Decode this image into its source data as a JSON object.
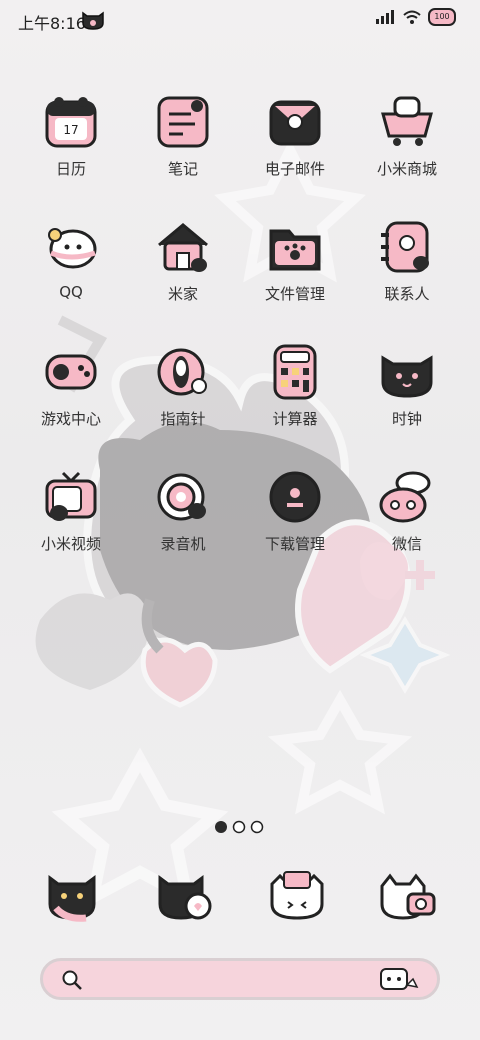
{
  "status_bar": {
    "time": "上午8:16",
    "battery": "100"
  },
  "apps": [
    {
      "label": "日历",
      "icon": "calendar-icon",
      "date": "17"
    },
    {
      "label": "笔记",
      "icon": "notes-icon"
    },
    {
      "label": "电子邮件",
      "icon": "email-icon"
    },
    {
      "label": "小米商城",
      "icon": "shop-cart-icon"
    },
    {
      "label": "QQ",
      "icon": "qq-icon"
    },
    {
      "label": "米家",
      "icon": "home-icon"
    },
    {
      "label": "文件管理",
      "icon": "folder-icon"
    },
    {
      "label": "联系人",
      "icon": "contacts-icon"
    },
    {
      "label": "游戏中心",
      "icon": "gamepad-icon"
    },
    {
      "label": "指南针",
      "icon": "compass-icon"
    },
    {
      "label": "计算器",
      "icon": "calculator-icon"
    },
    {
      "label": "时钟",
      "icon": "clock-icon"
    },
    {
      "label": "小米视频",
      "icon": "tv-icon"
    },
    {
      "label": "录音机",
      "icon": "recorder-icon"
    },
    {
      "label": "下载管理",
      "icon": "download-icon"
    },
    {
      "label": "微信",
      "icon": "wechat-icon"
    }
  ],
  "page_indicator": {
    "pages": 3,
    "current": 1
  },
  "dock": [
    {
      "icon": "phone-icon"
    },
    {
      "icon": "messages-icon"
    },
    {
      "icon": "mail-cat-icon"
    },
    {
      "icon": "camera-icon"
    }
  ],
  "colors": {
    "pink": "#f6b9c6",
    "dark": "#2b2b2b",
    "outline": "#222222"
  }
}
